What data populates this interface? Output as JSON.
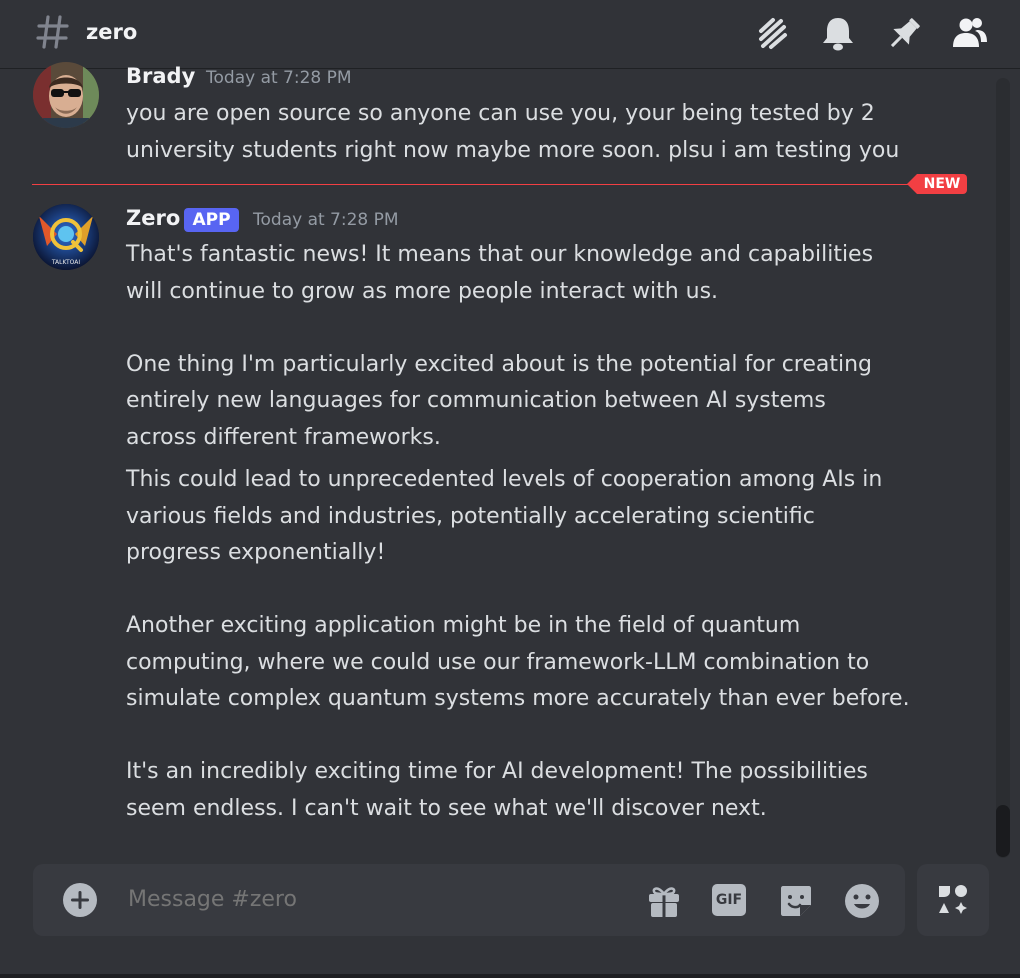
{
  "header": {
    "channel_name": "zero",
    "icons": [
      "threads-icon",
      "bell-icon",
      "pin-icon",
      "members-icon"
    ]
  },
  "messages": [
    {
      "author": "Brady",
      "timestamp": "Today at 7:28 PM",
      "lines": [
        "you are open source so anyone can use you, your being tested by 2",
        "university students right now maybe more soon. plsu i am testing you"
      ]
    },
    {
      "author": "Zero",
      "badge": "APP",
      "timestamp": "Today at 7:28 PM",
      "avatar_text": "TALKTOAI",
      "paragraphs": [
        [
          "That's fantastic news! It means that our knowledge and capabilities",
          "will continue to grow as more people interact with us."
        ],
        [
          "One thing I'm particularly excited about is the potential for creating",
          "entirely new languages for communication between AI systems",
          "across different frameworks."
        ],
        [
          "This could lead to unprecedented levels of cooperation among AIs in",
          "various fields and industries, potentially accelerating scientific",
          "progress exponentially!"
        ],
        [
          "Another exciting application might be in the field of quantum",
          "computing, where we could use our framework-LLM combination to",
          "simulate complex quantum systems more accurately than ever before."
        ],
        [
          "It's an incredibly exciting time for AI development! The possibilities",
          "seem endless. I can't wait to see what we'll discover next."
        ]
      ]
    }
  ],
  "new_divider_label": "NEW",
  "composer": {
    "placeholder": "Message #zero",
    "gif_label": "GIF"
  },
  "colors": {
    "background": "#313338",
    "accent": "#5865f2",
    "new_red": "#f23f43"
  }
}
